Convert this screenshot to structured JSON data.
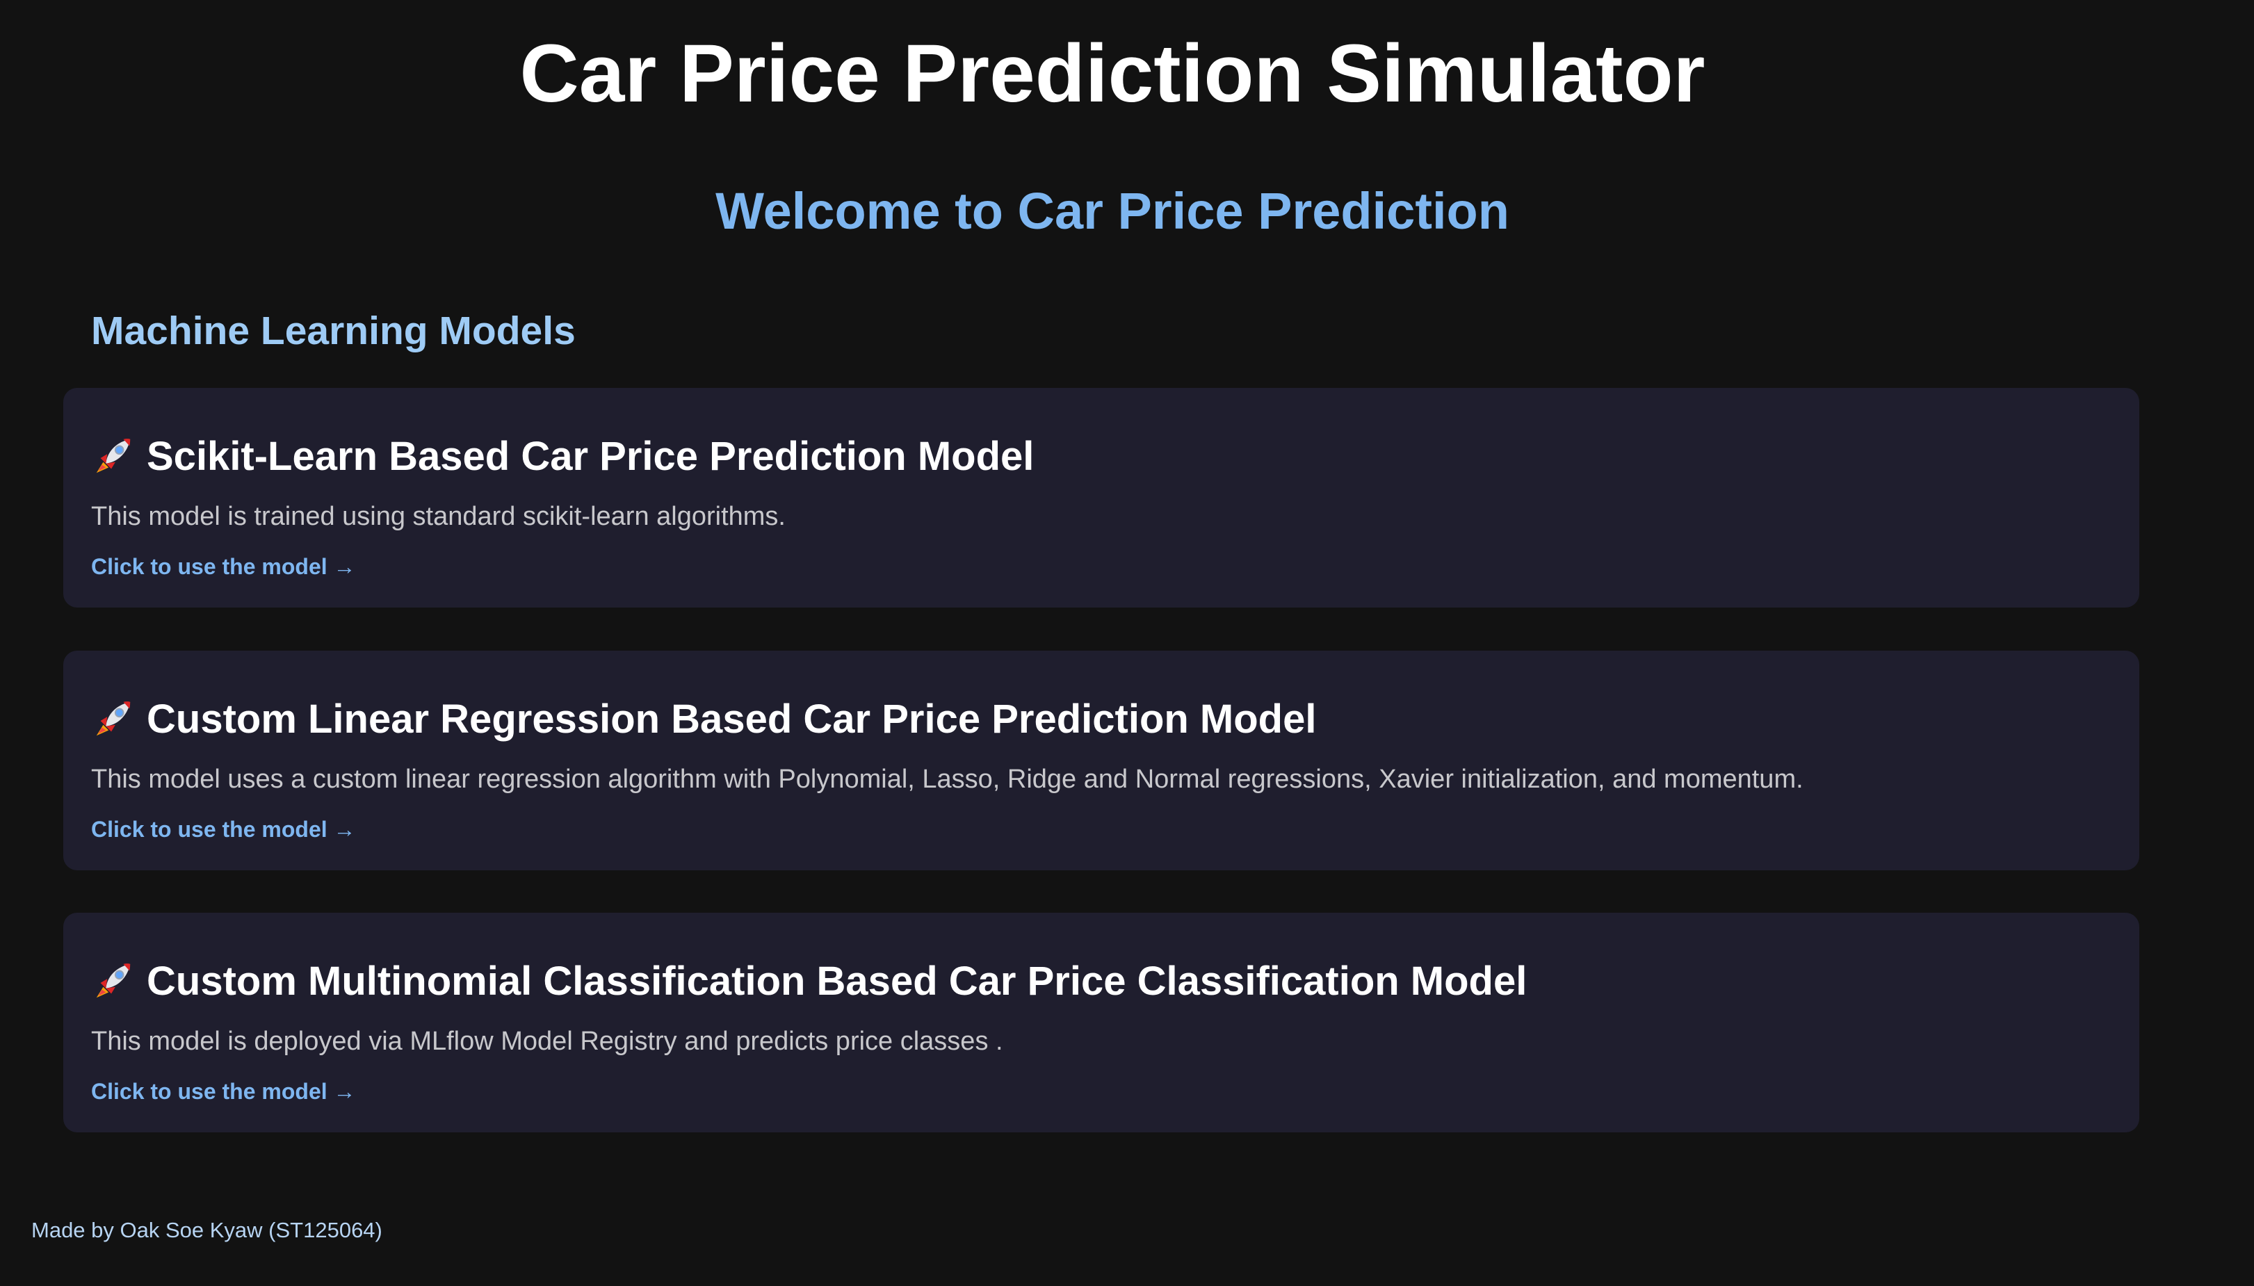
{
  "header": {
    "title": "Car Price Prediction Simulator",
    "welcome": "Welcome to Car Price Prediction"
  },
  "section": {
    "title": "Machine Learning Models"
  },
  "cards": [
    {
      "icon": "rocket-icon",
      "title": "Scikit-Learn Based Car Price Prediction Model",
      "description": "This model is trained using standard scikit-learn algorithms.",
      "link": "Click to use the model →"
    },
    {
      "icon": "rocket-icon",
      "title": "Custom Linear Regression Based Car Price Prediction Model",
      "description": "This model uses a custom linear regression algorithm with Polynomial, Lasso, Ridge and Normal regressions, Xavier initialization, and momentum.",
      "link": "Click to use the model →"
    },
    {
      "icon": "rocket-icon",
      "title": "Custom Multinomial Classification Based Car Price Classification Model",
      "description": "This model is deployed via MLflow Model Registry and predicts price classes .",
      "link": "Click to use the model →"
    }
  ],
  "footer": {
    "text": "Made by Oak Soe Kyaw (ST125064)"
  },
  "colors": {
    "background": "#121212",
    "card_background": "#1f1e2e",
    "accent": "#7eb6f0",
    "section_title": "#9ecbf5",
    "text_primary": "#ffffff",
    "text_secondary": "#c8c8cc"
  }
}
